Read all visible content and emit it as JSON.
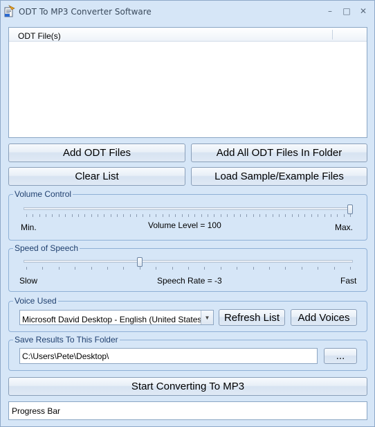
{
  "window": {
    "title": "ODT To MP3 Converter Software",
    "minimize_glyph": "–",
    "maximize_glyph": "□",
    "close_glyph": "✕"
  },
  "file_list": {
    "column_header": "ODT File(s)"
  },
  "buttons": {
    "add_files": "Add ODT Files",
    "add_folder": "Add All ODT Files In Folder",
    "clear_list": "Clear List",
    "load_samples": "Load Sample/Example Files",
    "refresh_list": "Refresh List",
    "add_voices": "Add Voices",
    "browse": "...",
    "start": "Start Converting To MP3"
  },
  "volume": {
    "group_title": "Volume Control",
    "min_label": "Min.",
    "max_label": "Max.",
    "level_label": "Volume Level = 100",
    "value": 100,
    "min": 0,
    "max": 100
  },
  "speed": {
    "group_title": "Speed of Speech",
    "slow_label": "Slow",
    "fast_label": "Fast",
    "rate_label": "Speech Rate = -3",
    "value": -3,
    "min": -10,
    "max": 10
  },
  "voice": {
    "group_title": "Voice Used",
    "selected": "Microsoft David Desktop - English (United States)"
  },
  "output": {
    "group_title": "Save Results To This Folder",
    "folder": "C:\\Users\\Pete\\Desktop\\"
  },
  "progress": {
    "label": "Progress Bar"
  }
}
